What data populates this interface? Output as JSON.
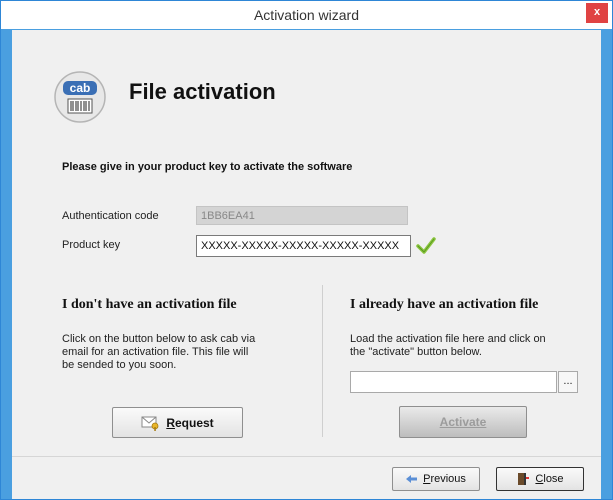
{
  "window": {
    "title": "Activation wizard",
    "close_glyph": "x"
  },
  "header": {
    "title": "File activation",
    "logo_text": "cab",
    "logo_icon": "cab-logo-icon"
  },
  "prompt": "Please give in your product key to activate the software",
  "fields": {
    "auth_label": "Authentication code",
    "auth_value": "1BB6EA41",
    "product_label": "Product key",
    "product_value": "XXXXX-XXXXX-XXXXX-XXXXX-XXXXX",
    "product_valid": true
  },
  "left": {
    "title": "I don't have an activation file",
    "desc_line1": "Click on the button below to ask cab via",
    "desc_line2": "email for an activation file. This file will",
    "desc_line3": "be sended to you soon.",
    "request_label": "equest",
    "request_accel": "R"
  },
  "right": {
    "title": "I already have an activation file",
    "desc_line1": "Load the activation file here and click on",
    "desc_line2": "the \"activate\" button below.",
    "file_value": "",
    "browse_label": "...",
    "activate_label": "Activate"
  },
  "footer": {
    "previous_accel": "P",
    "previous_label": "revious",
    "close_accel": "C",
    "close_label": "lose"
  },
  "colors": {
    "accent": "#4a9fe0",
    "close_red": "#e04343"
  }
}
